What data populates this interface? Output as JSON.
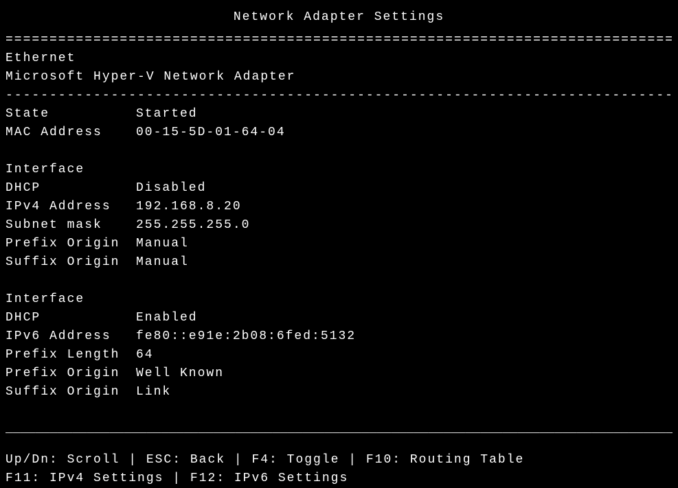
{
  "title": "Network Adapter Settings",
  "dividers": {
    "equals": "==============================================================================",
    "dash": "------------------------------------------------------------------------------",
    "underscore": "_______________________________________________________________________________________________________________________________________________________________"
  },
  "adapter": {
    "name": "Ethernet",
    "description": "Microsoft Hyper-V Network Adapter"
  },
  "state": {
    "label": "State",
    "value": "Started"
  },
  "mac": {
    "label": "MAC Address",
    "value": "00-15-5D-01-64-04"
  },
  "interfaces": [
    {
      "heading": "Interface",
      "rows": [
        {
          "label": "DHCP",
          "value": "Disabled"
        },
        {
          "label": "IPv4 Address",
          "value": "192.168.8.20"
        },
        {
          "label": "Subnet mask",
          "value": "255.255.255.0"
        },
        {
          "label": "Prefix Origin",
          "value": "Manual"
        },
        {
          "label": "Suffix Origin",
          "value": "Manual"
        }
      ]
    },
    {
      "heading": "Interface",
      "rows": [
        {
          "label": "DHCP",
          "value": "Enabled"
        },
        {
          "label": "IPv6 Address",
          "value": "fe80::e91e:2b08:6fed:5132"
        },
        {
          "label": "Prefix Length",
          "value": "64"
        },
        {
          "label": "Prefix Origin",
          "value": "Well Known"
        },
        {
          "label": "Suffix Origin",
          "value": "Link"
        }
      ]
    }
  ],
  "footer": {
    "line1": "Up/Dn: Scroll | ESC: Back | F4: Toggle | F10: Routing Table",
    "line2": "F11: IPv4 Settings | F12: IPv6 Settings"
  }
}
